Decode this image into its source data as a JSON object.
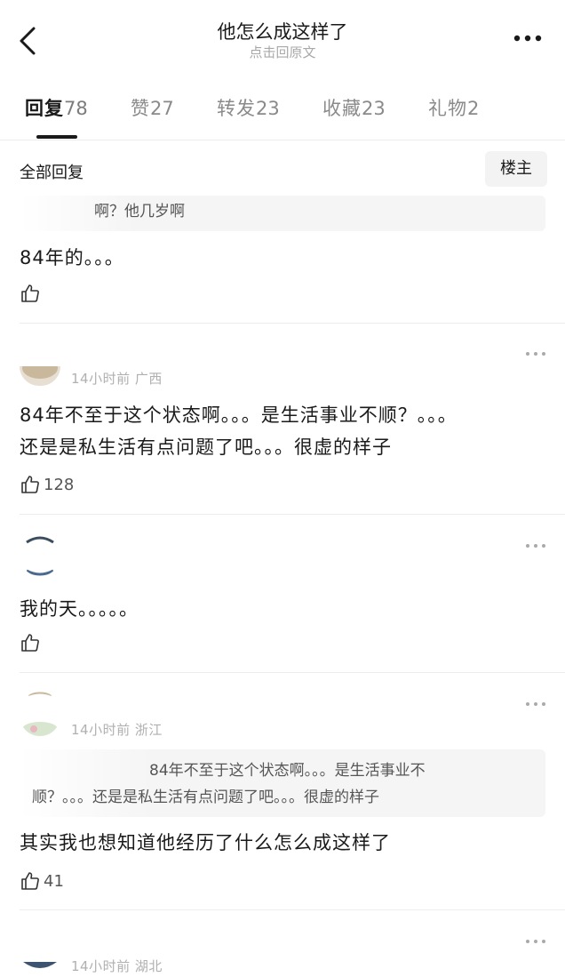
{
  "header": {
    "title": "他怎么成这样了",
    "subtitle": "点击回原文"
  },
  "tabs": [
    {
      "label": "回复",
      "count": "78",
      "active": true
    },
    {
      "label": "赞",
      "count": "27"
    },
    {
      "label": "转发",
      "count": "23"
    },
    {
      "label": "收藏",
      "count": "23"
    },
    {
      "label": "礼物",
      "count": "2"
    }
  ],
  "section": {
    "title": "全部回复",
    "owner_button": "楼主"
  },
  "comments": [
    {
      "quote": "啊？他几岁啊",
      "text": "84年的。。。",
      "likes": ""
    },
    {
      "meta": "14小时前 广西",
      "text_lines": [
        "84年不至于这个状态啊。。。是生活事业不顺？。。。",
        "还是是私生活有点问题了吧。。。很虚的样子"
      ],
      "likes": "128"
    },
    {
      "text": "我的天。。。。。",
      "likes": ""
    },
    {
      "meta": "14小时前 浙江",
      "quote_lines": [
        "84年不至于这个状态啊。。。是生活事业不",
        "顺？。。。还是是私生活有点问题了吧。。。很虚的样子"
      ],
      "text": "其实我也想知道他经历了什么怎么成这样了",
      "likes": "41"
    },
    {
      "meta": "14小时前 湖北"
    }
  ],
  "colors": {
    "text": "#1a1a1a",
    "muted": "#8a8a8a",
    "quote_bg": "#f5f5f5",
    "divider": "#ececec"
  }
}
